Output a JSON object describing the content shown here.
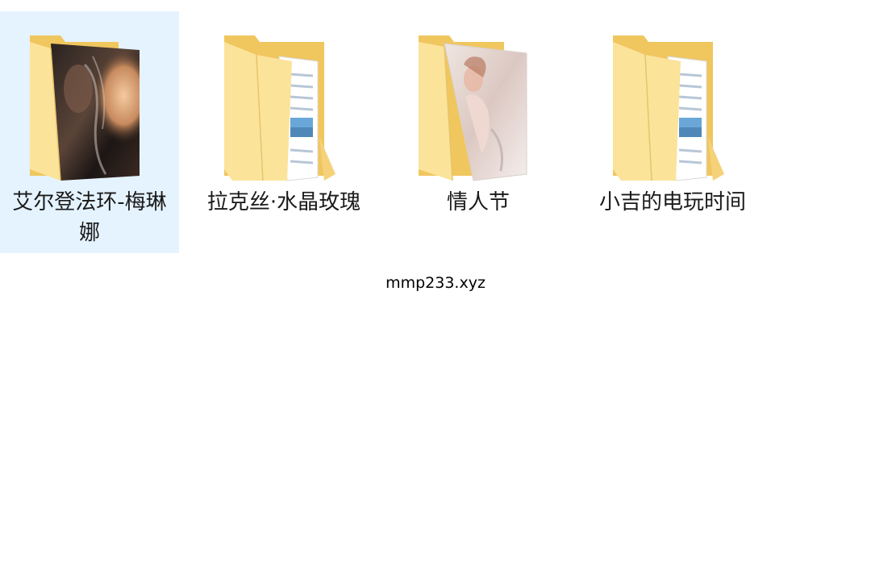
{
  "folders": [
    {
      "name": "艾尔登法环-梅琳娜",
      "preview": "dark-portrait",
      "selected": true
    },
    {
      "name": "拉克丝·水晶玫瑰",
      "preview": "document-pages",
      "selected": false
    },
    {
      "name": "情人节",
      "preview": "light-portrait",
      "selected": false
    },
    {
      "name": "小吉的电玩时间",
      "preview": "document-pages",
      "selected": false
    }
  ],
  "watermark": "mmp233.xyz",
  "colors": {
    "selection": "#e5f3ff",
    "folder_back": "#f0c65e",
    "folder_front": "#fbe39a",
    "text": "#1a1a1a"
  },
  "icons": [
    "folder-icon"
  ]
}
